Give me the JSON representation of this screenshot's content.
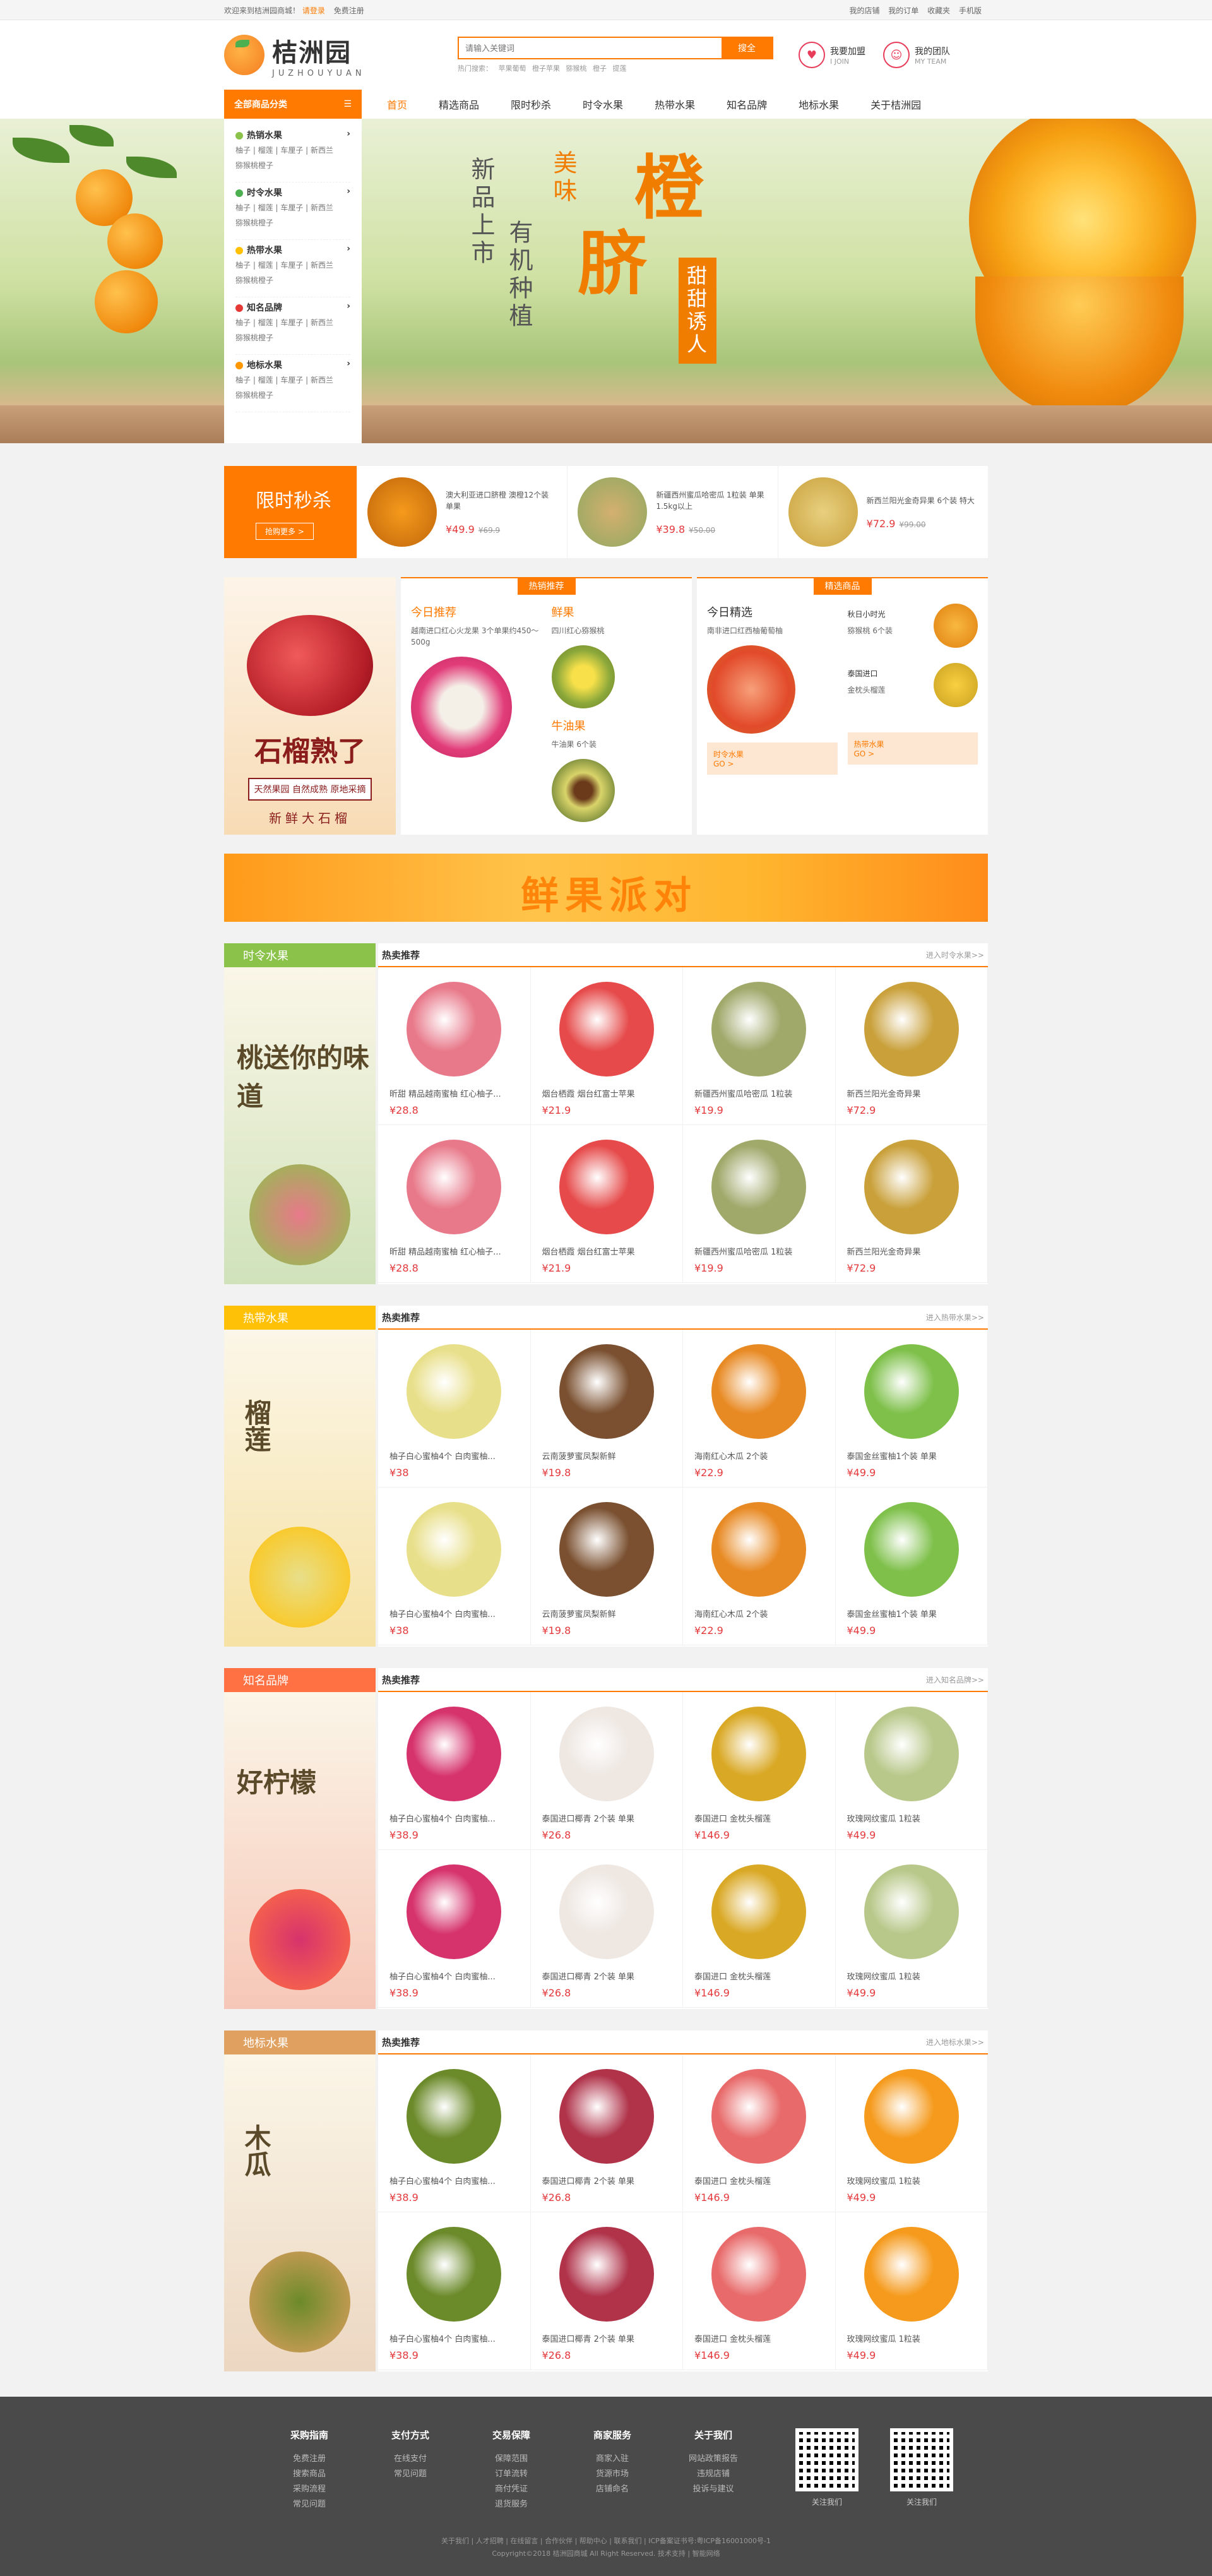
{
  "topbar": {
    "welcome": "欢迎来到桔洲园商城！",
    "login": "请登录",
    "register": "免费注册",
    "links": [
      "我的店铺",
      "我的订单",
      "收藏夹",
      "手机版"
    ]
  },
  "logo": {
    "cn": "桔洲园",
    "en": "JUZHOUYUAN"
  },
  "search": {
    "placeholder": "请输入关键词",
    "button": "搜全",
    "hot": [
      "热门搜索：",
      "苹果葡萄",
      "橙子苹果",
      "猕猴桃",
      "橙子",
      "提莲"
    ]
  },
  "header_links": [
    {
      "t1": "我要加盟",
      "t2": "I JOIN"
    },
    {
      "t1": "我的团队",
      "t2": "MY TEAM"
    }
  ],
  "nav": {
    "category": "全部商品分类",
    "items": [
      "首页",
      "精选商品",
      "限时秒杀",
      "时令水果",
      "热带水果",
      "知名品牌",
      "地标水果",
      "关于桔洲园"
    ]
  },
  "categories": [
    {
      "name": "热销水果",
      "color": "#8bc34a",
      "sub": "柚子 | 榴莲 | 车厘子 | 新西兰",
      "sub2": "猕猴桃橙子"
    },
    {
      "name": "时令水果",
      "color": "#4caf50",
      "sub": "柚子 | 榴莲 | 车厘子 | 新西兰",
      "sub2": "猕猴桃橙子"
    },
    {
      "name": "热带水果",
      "color": "#ffc107",
      "sub": "柚子 | 榴莲 | 车厘子 | 新西兰",
      "sub2": "猕猴桃橙子"
    },
    {
      "name": "知名品牌",
      "color": "#e53935",
      "sub": "柚子 | 榴莲 | 车厘子 | 新西兰",
      "sub2": "猕猴桃橙子"
    },
    {
      "name": "地标水果",
      "color": "#ff9800",
      "sub": "柚子 | 榴莲 | 车厘子 | 新西兰",
      "sub2": "猕猴桃橙子"
    }
  ],
  "banner": {
    "v1": "新品上市",
    "v2": "有机种植",
    "v3": "美味",
    "big1": "脐",
    "big2": "橙",
    "tag": "甜甜诱人"
  },
  "flash": {
    "title": "限时秒杀",
    "more": "抢购更多 >",
    "items": [
      {
        "name": "澳大利亚进口脐橙 澳橙12个装 单果",
        "price": "¥49.9",
        "old": "¥69.9",
        "color": "#f59a1c"
      },
      {
        "name": "新疆西州蜜瓜哈密瓜 1粒装 单果1.5kg以上",
        "price": "¥39.8",
        "old": "¥50.00",
        "color": "#8fa860"
      },
      {
        "name": "新西兰阳光金奇异果 6个装 特大",
        "price": "¥72.9",
        "old": "¥99.00",
        "color": "#c9a03a"
      }
    ]
  },
  "rec": {
    "side_big": "石榴熟了",
    "side_sub": "天然果园 自然成熟 原地采摘",
    "side_sub2": "新鲜大石榴",
    "hot_label": "热销推荐",
    "pick_label": "精选商品",
    "today": "今日推荐",
    "today_desc": "越南进口红心火龙果 3个单果约450～500g",
    "a1": "鲜果",
    "a1d": "四川红心猕猴桃",
    "a2": "牛油果",
    "a2d": "牛油果 6个装",
    "pick": "今日精选",
    "pick_desc": "南非进口红西柚葡萄柚",
    "p1": "秋日小时光",
    "p1d": "猕猴桃 6个装",
    "p2": "泰国进口",
    "p2d": "金枕头榴莲",
    "go1": "时令水果",
    "go2": "热带水果",
    "go": "GO >"
  },
  "promo": {
    "text": "鲜果派对"
  },
  "floors": [
    {
      "label": "时令水果",
      "color": "#8bc34a",
      "side": "桃送你的味道",
      "hot": "热卖推荐",
      "more": "进入时令水果>>",
      "items": [
        {
          "name": "昕甜 精品越南蜜柚 红心柚子...",
          "price": "¥28.8",
          "color": "#e8798a"
        },
        {
          "name": "烟台栖霞 烟台红富士苹果",
          "price": "¥21.9",
          "color": "#e64a4a"
        },
        {
          "name": "新疆西州蜜瓜哈密瓜 1粒装",
          "price": "¥19.9",
          "color": "#a0a86a"
        },
        {
          "name": "新西兰阳光金奇异果",
          "price": "¥72.9",
          "color": "#c9a03a"
        },
        {
          "name": "昕甜 精品越南蜜柚 红心柚子...",
          "price": "¥28.8",
          "color": "#e8798a"
        },
        {
          "name": "烟台栖霞 烟台红富士苹果",
          "price": "¥21.9",
          "color": "#e64a4a"
        },
        {
          "name": "新疆西州蜜瓜哈密瓜 1粒装",
          "price": "¥19.9",
          "color": "#a0a86a"
        },
        {
          "name": "新西兰阳光金奇异果",
          "price": "¥72.9",
          "color": "#c9a03a"
        }
      ]
    },
    {
      "label": "热带水果",
      "color": "#ffc107",
      "side": "榴莲",
      "hot": "热卖推荐",
      "more": "进入热带水果>>",
      "items": [
        {
          "name": "柚子白心蜜柚4个 白肉蜜柚...",
          "price": "¥38",
          "color": "#e8df8a"
        },
        {
          "name": "云南菠萝蜜凤梨新鲜",
          "price": "¥19.8",
          "color": "#7a5030"
        },
        {
          "name": "海南红心木瓜 2个装",
          "price": "¥22.9",
          "color": "#e88a24"
        },
        {
          "name": "泰国金丝蜜柚1个装 单果",
          "price": "¥49.9",
          "color": "#7ec04a"
        },
        {
          "name": "柚子白心蜜柚4个 白肉蜜柚...",
          "price": "¥38",
          "color": "#e8df8a"
        },
        {
          "name": "云南菠萝蜜凤梨新鲜",
          "price": "¥19.8",
          "color": "#7a5030"
        },
        {
          "name": "海南红心木瓜 2个装",
          "price": "¥22.9",
          "color": "#e88a24"
        },
        {
          "name": "泰国金丝蜜柚1个装 单果",
          "price": "¥49.9",
          "color": "#7ec04a"
        }
      ]
    },
    {
      "label": "知名品牌",
      "color": "#ff7043",
      "side": "好柠檬",
      "hot": "热卖推荐",
      "more": "进入知名品牌>>",
      "items": [
        {
          "name": "柚子白心蜜柚4个 白肉蜜柚...",
          "price": "¥38.9",
          "color": "#d6336c"
        },
        {
          "name": "泰国进口椰青 2个装 单果",
          "price": "¥26.8",
          "color": "#eee7e2"
        },
        {
          "name": "泰国进口 金枕头榴莲",
          "price": "¥146.9",
          "color": "#d9a825"
        },
        {
          "name": "玫瑰网纹蜜瓜 1粒装",
          "price": "¥49.9",
          "color": "#b8c88a"
        },
        {
          "name": "柚子白心蜜柚4个 白肉蜜柚...",
          "price": "¥38.9",
          "color": "#d6336c"
        },
        {
          "name": "泰国进口椰青 2个装 单果",
          "price": "¥26.8",
          "color": "#eee7e2"
        },
        {
          "name": "泰国进口 金枕头榴莲",
          "price": "¥146.9",
          "color": "#d9a825"
        },
        {
          "name": "玫瑰网纹蜜瓜 1粒装",
          "price": "¥49.9",
          "color": "#b8c88a"
        }
      ]
    },
    {
      "label": "地标水果",
      "color": "#e0a060",
      "side": "木瓜",
      "hot": "热卖推荐",
      "more": "进入地标水果>>",
      "items": [
        {
          "name": "柚子白心蜜柚4个 白肉蜜柚...",
          "price": "¥38.9",
          "color": "#6b8a2a"
        },
        {
          "name": "泰国进口椰青 2个装 单果",
          "price": "¥26.8",
          "color": "#b0334a"
        },
        {
          "name": "泰国进口 金枕头榴莲",
          "price": "¥146.9",
          "color": "#e86a6a"
        },
        {
          "name": "玫瑰网纹蜜瓜 1粒装",
          "price": "¥49.9",
          "color": "#f59a1c"
        },
        {
          "name": "柚子白心蜜柚4个 白肉蜜柚...",
          "price": "¥38.9",
          "color": "#6b8a2a"
        },
        {
          "name": "泰国进口椰青 2个装 单果",
          "price": "¥26.8",
          "color": "#b0334a"
        },
        {
          "name": "泰国进口 金枕头榴莲",
          "price": "¥146.9",
          "color": "#e86a6a"
        },
        {
          "name": "玫瑰网纹蜜瓜 1粒装",
          "price": "¥49.9",
          "color": "#f59a1c"
        }
      ]
    }
  ],
  "footer": {
    "cols": [
      {
        "title": "采购指南",
        "links": [
          "免费注册",
          "搜索商品",
          "采购流程",
          "常见问题"
        ]
      },
      {
        "title": "支付方式",
        "links": [
          "在线支付",
          "常见问题"
        ]
      },
      {
        "title": "交易保障",
        "links": [
          "保障范围",
          "订单流转",
          "商付凭证",
          "退货服务"
        ]
      },
      {
        "title": "商家服务",
        "links": [
          "商家入驻",
          "货源市场",
          "店铺命名"
        ]
      },
      {
        "title": "关于我们",
        "links": [
          "网站政策报告",
          "违规店铺",
          "投诉与建议"
        ]
      }
    ],
    "qr": [
      "关注我们",
      "关注我们"
    ],
    "copy1": "关于我们 | 人才招聘 | 在线留言 | 合作伙伴 | 帮助中心 | 联系我们 | ICP备案证书号:粤ICP备16001000号-1",
    "copy2": "Copyright©2018 桔洲园商城 All Right Reserved. 技术支持 | 智能网络"
  }
}
